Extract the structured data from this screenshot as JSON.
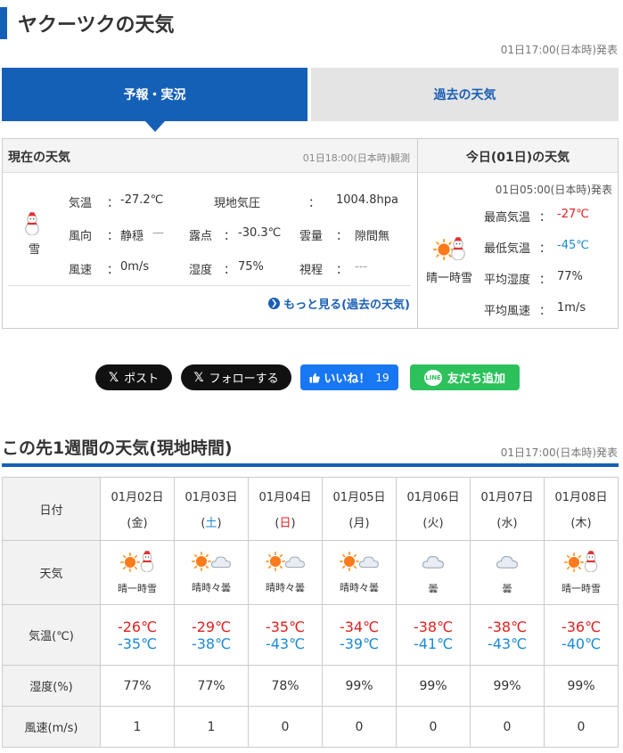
{
  "page": {
    "title": "ヤクーツクの天気",
    "issued": "01日17:00(日本時)発表"
  },
  "tabs": [
    {
      "label": "予報・実況"
    },
    {
      "label": "過去の天気"
    }
  ],
  "current": {
    "heading": "現在の天気",
    "observed": "01日18:00(日本時)観測",
    "weather": "雪",
    "rows": [
      {
        "label": "気温",
        "sep": "：",
        "value": "-27.2℃"
      },
      {
        "label": "現地気圧",
        "sep": "：",
        "value": "1004.8hpa"
      },
      {
        "label": "風向",
        "sep": "：",
        "value": "静穏",
        "extra": "—"
      },
      {
        "label": "露点",
        "sep": "：",
        "value": "-30.3℃"
      },
      {
        "label": "雲量",
        "sep": "：",
        "value": "隙間無"
      },
      {
        "label": "風速",
        "sep": "：",
        "value": "0m/s"
      },
      {
        "label": "湿度",
        "sep": "：",
        "value": "75%"
      },
      {
        "label": "視程",
        "sep": "：",
        "value": "---"
      }
    ],
    "more_link": "もっと見る(過去の天気)"
  },
  "today": {
    "heading": "今日(01日)の天気",
    "issued": "01日05:00(日本時)発表",
    "weather": "晴一時雪",
    "rows": [
      {
        "label": "最高気温",
        "sep": "：",
        "value": "-27℃"
      },
      {
        "label": "最低気温",
        "sep": "：",
        "value": "-45℃"
      },
      {
        "label": "平均湿度",
        "sep": "：",
        "value": "77%"
      },
      {
        "label": "平均風速",
        "sep": "：",
        "value": "1m/s"
      }
    ]
  },
  "social": {
    "post": "ポスト",
    "follow": "フォローする",
    "like": "いいね！",
    "like_count": "19",
    "line_logo": "LINE",
    "line": "友だち追加",
    "x_glyph": "𝕏"
  },
  "week": {
    "title": "この先1週間の天気(現地時間)",
    "issued": "01日17:00(日本時)発表",
    "row_labels": {
      "date": "日付",
      "weather": "天気",
      "temp": "気温(℃)",
      "humidity": "湿度(%)",
      "wind": "風速(m/s)"
    },
    "days": [
      {
        "date": "01月02日",
        "weekday": "(金)",
        "type": "weekday",
        "icon": "sun-snow-icon",
        "weather": "晴一時雪",
        "max": "-26℃",
        "min": "-35℃",
        "humidity": "77%",
        "wind": "1"
      },
      {
        "date": "01月03日",
        "weekday": "(土)",
        "type": "sat",
        "icon": "sun-cloud-icon",
        "weather": "晴時々曇",
        "max": "-29℃",
        "min": "-38℃",
        "humidity": "77%",
        "wind": "1"
      },
      {
        "date": "01月04日",
        "weekday": "(日)",
        "type": "sun",
        "icon": "sun-cloud-icon",
        "weather": "晴時々曇",
        "max": "-35℃",
        "min": "-43℃",
        "humidity": "78%",
        "wind": "0"
      },
      {
        "date": "01月05日",
        "weekday": "(月)",
        "type": "weekday",
        "icon": "sun-cloud-icon",
        "weather": "晴時々曇",
        "max": "-34℃",
        "min": "-39℃",
        "humidity": "99%",
        "wind": "0"
      },
      {
        "date": "01月06日",
        "weekday": "(火)",
        "type": "weekday",
        "icon": "cloud-icon",
        "weather": "曇",
        "max": "-38℃",
        "min": "-41℃",
        "humidity": "99%",
        "wind": "0"
      },
      {
        "date": "01月07日",
        "weekday": "(水)",
        "type": "weekday",
        "icon": "cloud-icon",
        "weather": "曇",
        "max": "-38℃",
        "min": "-43℃",
        "humidity": "99%",
        "wind": "0"
      },
      {
        "date": "01月08日",
        "weekday": "(木)",
        "type": "weekday",
        "icon": "sun-snow-icon",
        "weather": "晴一時雪",
        "max": "-36℃",
        "min": "-40℃",
        "humidity": "99%",
        "wind": "0"
      }
    ]
  },
  "colors": {
    "brand_blue": "#1560b7",
    "max_red": "#e02020",
    "min_blue": "#1a8ad4"
  }
}
